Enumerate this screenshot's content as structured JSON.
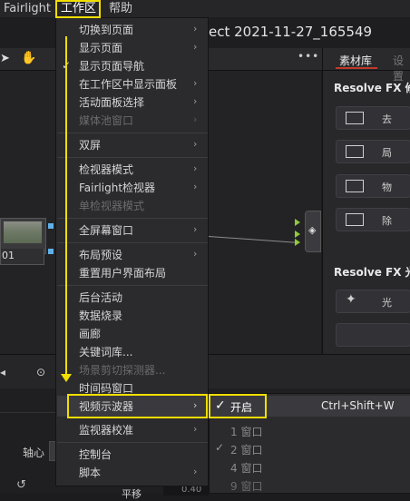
{
  "menubar": {
    "items": [
      "Fairlight",
      "工作区",
      "帮助"
    ]
  },
  "project_title": "ect 2021-11-27_165549",
  "toolbar": {
    "dots": "•••"
  },
  "right_panel": {
    "tabs": [
      "素材库",
      "设置"
    ],
    "section1_title": "Resolve FX 修复",
    "section2_title": "Resolve FX 光效",
    "fx_items": [
      "去",
      "局",
      "物",
      "除",
      "光"
    ]
  },
  "node": {
    "label": "01"
  },
  "bottom": {
    "axis_label": "轴心",
    "pan_label": "平移",
    "pan_value": "0.40"
  },
  "menu": {
    "items": [
      {
        "label": "切换到页面",
        "submenu": true,
        "disabled": false
      },
      {
        "label": "显示页面",
        "submenu": true,
        "disabled": false
      },
      {
        "label": "显示页面导航",
        "checked": true,
        "disabled": false
      },
      {
        "label": "在工作区中显示面板",
        "submenu": true,
        "disabled": false
      },
      {
        "label": "活动面板选择",
        "submenu": true,
        "disabled": false
      },
      {
        "label": "媒体池窗口",
        "submenu": true,
        "disabled": true
      },
      {
        "label": "双屏",
        "submenu": true,
        "disabled": false
      },
      {
        "label": "检视器模式",
        "submenu": true,
        "disabled": false
      },
      {
        "label": "Fairlight检视器",
        "submenu": true,
        "disabled": false
      },
      {
        "label": "单检视器模式",
        "disabled": true
      },
      {
        "label": "全屏幕窗口",
        "submenu": true,
        "disabled": false
      },
      {
        "label": "布局预设",
        "submenu": true,
        "disabled": false
      },
      {
        "label": "重置用户界面布局",
        "disabled": false
      },
      {
        "label": "后台活动",
        "disabled": false
      },
      {
        "label": "数据烧录",
        "disabled": false
      },
      {
        "label": "画廊",
        "disabled": false
      },
      {
        "label": "关键词库...",
        "disabled": false
      },
      {
        "label": "场景剪切探测器...",
        "disabled": true
      },
      {
        "label": "时间码窗口",
        "disabled": false
      },
      {
        "label": "视频示波器",
        "submenu": true,
        "disabled": false
      },
      {
        "label": "监视器校准",
        "submenu": true,
        "disabled": false
      },
      {
        "label": "控制台",
        "disabled": false
      },
      {
        "label": "脚本",
        "submenu": true,
        "disabled": false
      }
    ]
  },
  "submenu": {
    "items": [
      {
        "label": "开启",
        "shortcut": "Ctrl+Shift+W",
        "checked": true
      },
      {
        "label": "1 窗口",
        "checked": false
      },
      {
        "label": "2 窗口",
        "checked": true
      },
      {
        "label": "4 窗口",
        "checked": false
      },
      {
        "label": "9 窗口",
        "checked": false
      }
    ]
  },
  "glyphs": {
    "arrow": "›",
    "check": "✓"
  },
  "colors": {
    "highlight": "#f2de00",
    "accent_red": "#c0392b",
    "node_green": "#8fc93a"
  }
}
